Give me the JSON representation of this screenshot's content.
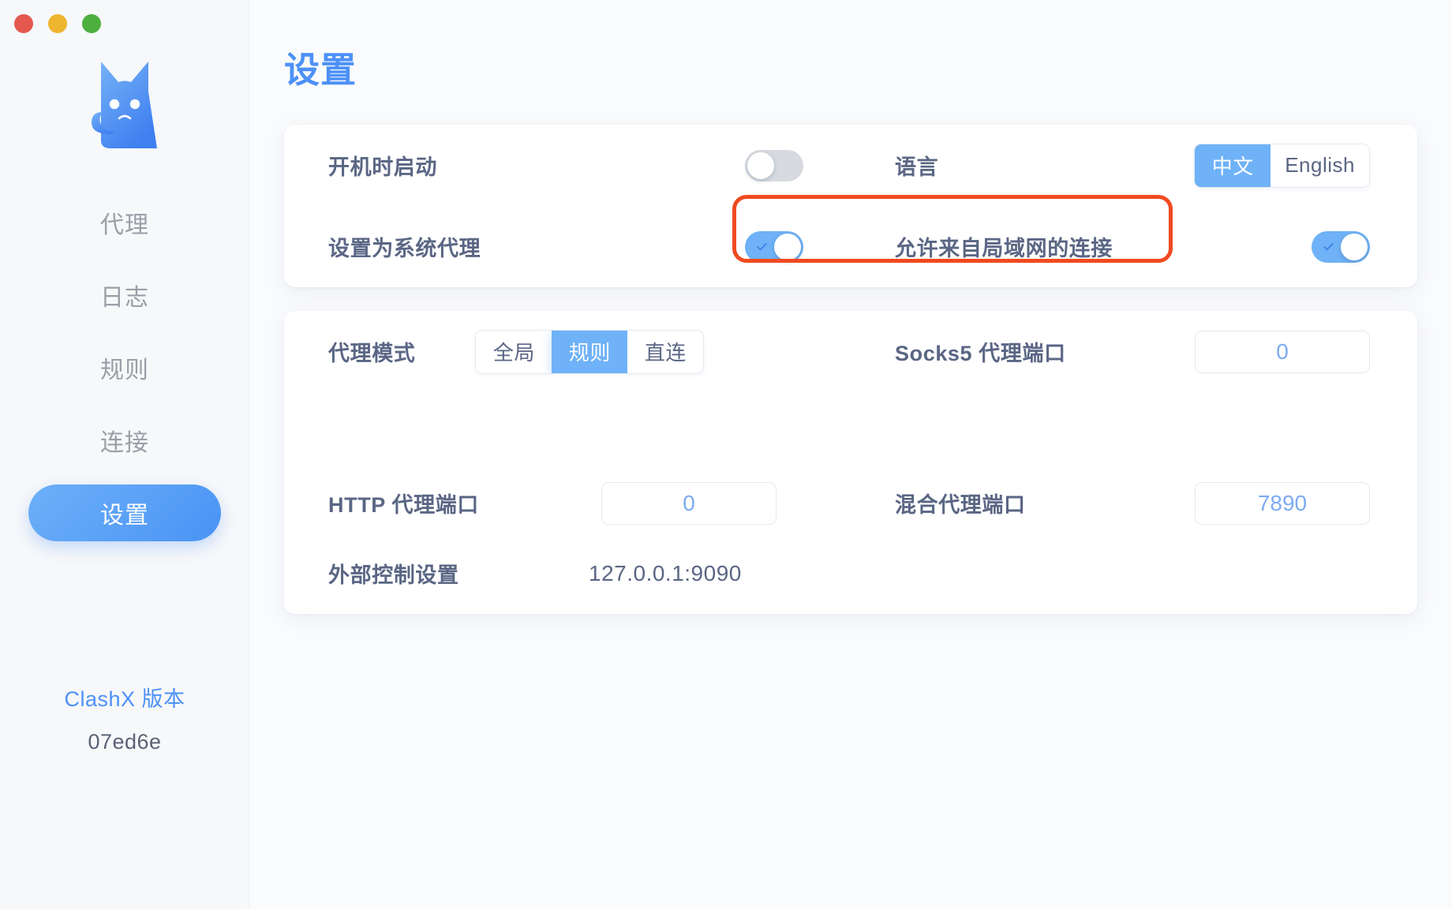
{
  "window": {
    "traffic_lights": [
      {
        "name": "close",
        "color": "#e4584f"
      },
      {
        "name": "minimize",
        "color": "#eeb52e"
      },
      {
        "name": "zoom",
        "color": "#4cb03e"
      }
    ]
  },
  "sidebar": {
    "logo_icon": "cat-logo-icon",
    "items": [
      {
        "label": "代理",
        "active": false
      },
      {
        "label": "日志",
        "active": false
      },
      {
        "label": "规则",
        "active": false
      },
      {
        "label": "连接",
        "active": false
      },
      {
        "label": "设置",
        "active": true
      }
    ],
    "version_title": "ClashX 版本",
    "version_hash": "07ed6e"
  },
  "main": {
    "page_title": "设置",
    "card_general": {
      "launch_at_login": {
        "label": "开机时启动",
        "value": false
      },
      "set_as_system_proxy": {
        "label": "设置为系统代理",
        "value": true
      },
      "language": {
        "label": "语言",
        "options": [
          "中文",
          "English"
        ],
        "selected": "中文"
      },
      "allow_lan": {
        "label": "允许来自局域网的连接",
        "value": true
      }
    },
    "card_proxy": {
      "proxy_mode": {
        "label": "代理模式",
        "options": [
          "全局",
          "规则",
          "直连"
        ],
        "selected": "规则"
      },
      "socks5_port": {
        "label": "Socks5 代理端口",
        "value": "0"
      },
      "http_port": {
        "label": "HTTP 代理端口",
        "value": "0"
      },
      "mixed_port": {
        "label": "混合代理端口",
        "value": "7890"
      },
      "external_controller": {
        "label": "外部控制设置",
        "value": "127.0.0.1:9090"
      }
    }
  },
  "annotation": {
    "highlight_target": "允许来自局域网的连接",
    "highlight_color": "#f04a20"
  },
  "colors": {
    "accent_blue": "#4d91f7",
    "toggle_on": "#6fb2f7",
    "label_text": "#5a6684",
    "nav_text": "#9b9ea6",
    "background": "#fafbfc",
    "sidebar_bg": "#f7f8fa"
  }
}
